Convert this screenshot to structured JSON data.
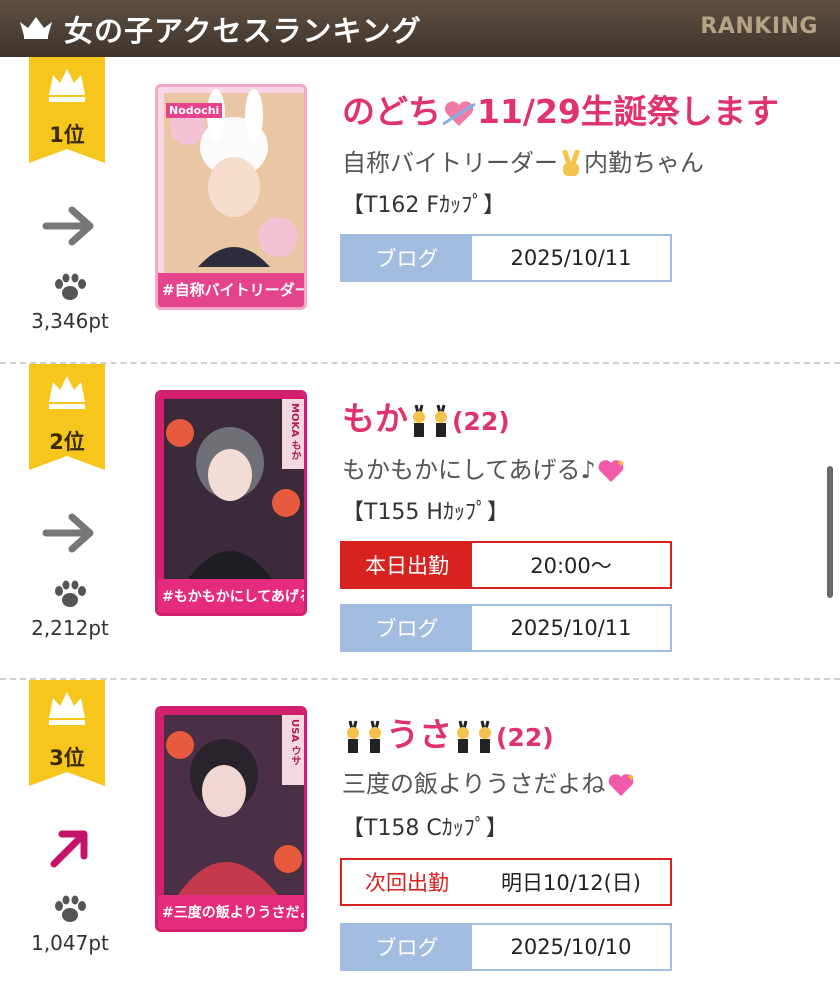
{
  "header": {
    "title": "女の子アクセスランキング",
    "ranking_label": "RANKING"
  },
  "entries": [
    {
      "rank": "1位",
      "trend": "flat",
      "points": "3,346pt",
      "name": "のどち",
      "name_suffix": "11/29生誕祭します",
      "tagline_a": "自称バイトリーダー",
      "tagline_b": "内勤ちゃん",
      "stats": "【T162 Fｶｯﾌﾟ】",
      "blog_label": "ブログ",
      "blog_date": "2025/10/11",
      "photo_caption": "#自称バイトリーダー",
      "photo_name": "Nodochi"
    },
    {
      "rank": "2位",
      "trend": "flat",
      "points": "2,212pt",
      "name": "もか",
      "age": "(22)",
      "tagline_a": "もかもかにしてあげる♪",
      "stats": "【T155 Hｶｯﾌﾟ】",
      "work_label": "本日出勤",
      "work_time": "20:00〜",
      "blog_label": "ブログ",
      "blog_date": "2025/10/11",
      "photo_caption": "#もかもかにしてあげる♪",
      "photo_name": "MOKA もか"
    },
    {
      "rank": "3位",
      "trend": "up",
      "points": "1,047pt",
      "name": "うさ",
      "age": "(22)",
      "tagline_a": "三度の飯よりうさだよね",
      "stats": "【T158 Cｶｯﾌﾟ】",
      "next_label": "次回出勤",
      "next_time": "明日10/12(日)",
      "blog_label": "ブログ",
      "blog_date": "2025/10/10",
      "photo_caption": "#三度の飯よりうさだよね",
      "photo_name": "USA ウサ"
    }
  ],
  "colors": {
    "accent": "#e0336b",
    "badge": "#f7c61c",
    "blog": "#a3bde0",
    "work": "#d7221f"
  }
}
